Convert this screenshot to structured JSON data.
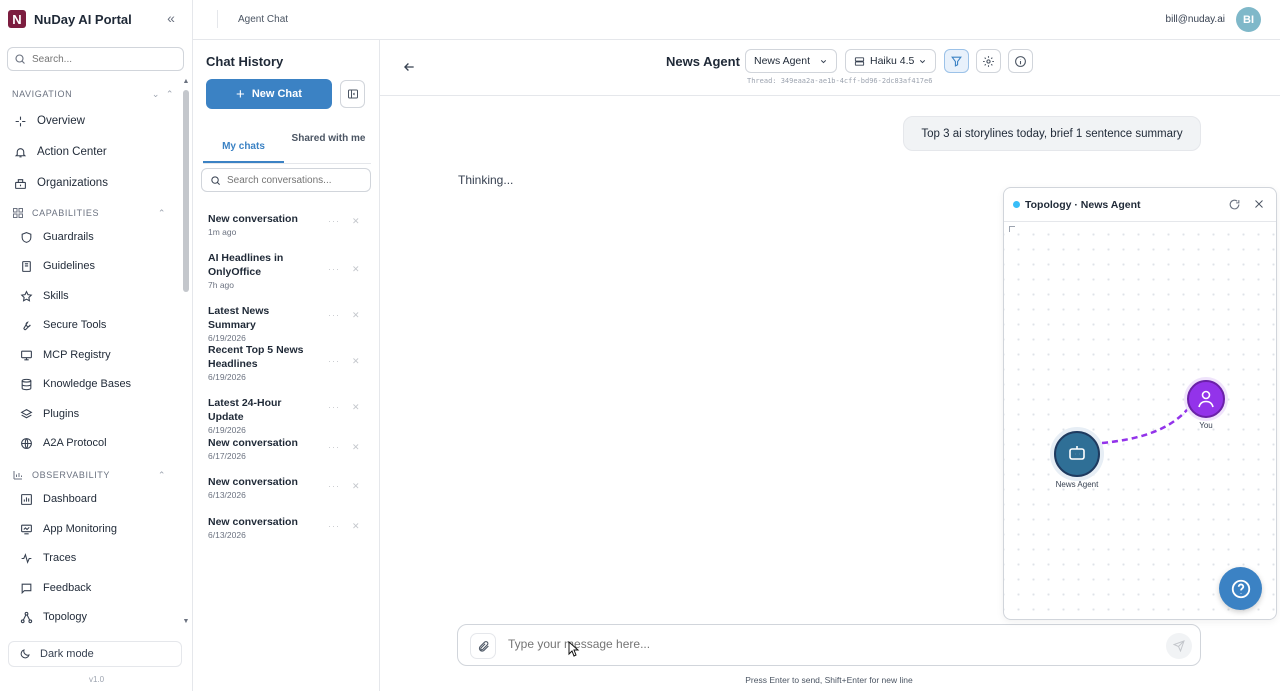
{
  "app": {
    "name": "NuDay AI Portal",
    "logo_letter": "N",
    "version": "v1.0",
    "brand_color": "#7c1d3f",
    "accent": "#3b82c4"
  },
  "sidebar": {
    "search_placeholder": "Search...",
    "navigation_label": "NAVIGATION",
    "capabilities_label": "CAPABILITIES",
    "observability_label": "OBSERVABILITY",
    "top_items": [
      {
        "label": "Overview",
        "icon": "sparkle-icon"
      },
      {
        "label": "Action Center",
        "icon": "bell-icon"
      },
      {
        "label": "Organizations",
        "icon": "org-icon"
      }
    ],
    "capabilities": [
      {
        "label": "Guardrails",
        "icon": "shield-icon"
      },
      {
        "label": "Guidelines",
        "icon": "book-icon"
      },
      {
        "label": "Skills",
        "icon": "star-icon"
      },
      {
        "label": "Secure Tools",
        "icon": "wrench-icon"
      },
      {
        "label": "MCP Registry",
        "icon": "monitor-icon"
      },
      {
        "label": "Knowledge Bases",
        "icon": "database-icon"
      },
      {
        "label": "Plugins",
        "icon": "layers-icon"
      },
      {
        "label": "A2A Protocol",
        "icon": "globe-icon"
      }
    ],
    "observability": [
      {
        "label": "Dashboard",
        "icon": "chart-icon"
      },
      {
        "label": "App Monitoring",
        "icon": "monitor-icon"
      },
      {
        "label": "Traces",
        "icon": "activity-icon"
      },
      {
        "label": "Feedback",
        "icon": "message-icon"
      },
      {
        "label": "Topology",
        "icon": "topology-icon"
      }
    ],
    "dark_mode_label": "Dark mode"
  },
  "topbar": {
    "breadcrumb": "Agent Chat",
    "user_email": "bill@nuday.ai",
    "avatar_initials": "BI"
  },
  "history": {
    "title": "Chat History",
    "new_chat_label": "New Chat",
    "tab_my": "My chats",
    "tab_shared": "Shared with me",
    "search_placeholder": "Search conversations...",
    "conversations": [
      {
        "title": "New conversation",
        "time": "1m ago"
      },
      {
        "title": "AI Headlines in OnlyOffice",
        "time": "7h ago"
      },
      {
        "title": "Latest News Summary",
        "time": "6/19/2026"
      },
      {
        "title": "Recent Top 5 News Headlines",
        "time": "6/19/2026"
      },
      {
        "title": "Latest 24-Hour Update",
        "time": "6/19/2026"
      },
      {
        "title": "New conversation",
        "time": "6/17/2026"
      },
      {
        "title": "New conversation",
        "time": "6/13/2026"
      },
      {
        "title": "New conversation",
        "time": "6/13/2026"
      }
    ]
  },
  "chat": {
    "agent_title": "News Agent",
    "agent_select": "News Agent",
    "model_select": "Haiku 4.5",
    "thread_id": "Thread: 349eaa2a-ae1b-4cff-bd96-2dc83af417e6",
    "user_message": "Top 3 ai storylines today, brief 1 sentence summary",
    "status": "Thinking...",
    "input_placeholder": "Type your message here...",
    "hint": "Press Enter to send, Shift+Enter for new line"
  },
  "topology": {
    "title": "Topology · News Agent",
    "nodes": [
      {
        "label": "News Agent",
        "color": "#2f6f96"
      },
      {
        "label": "You",
        "color": "#9333ea"
      }
    ],
    "edge_color": "#9333ea"
  }
}
